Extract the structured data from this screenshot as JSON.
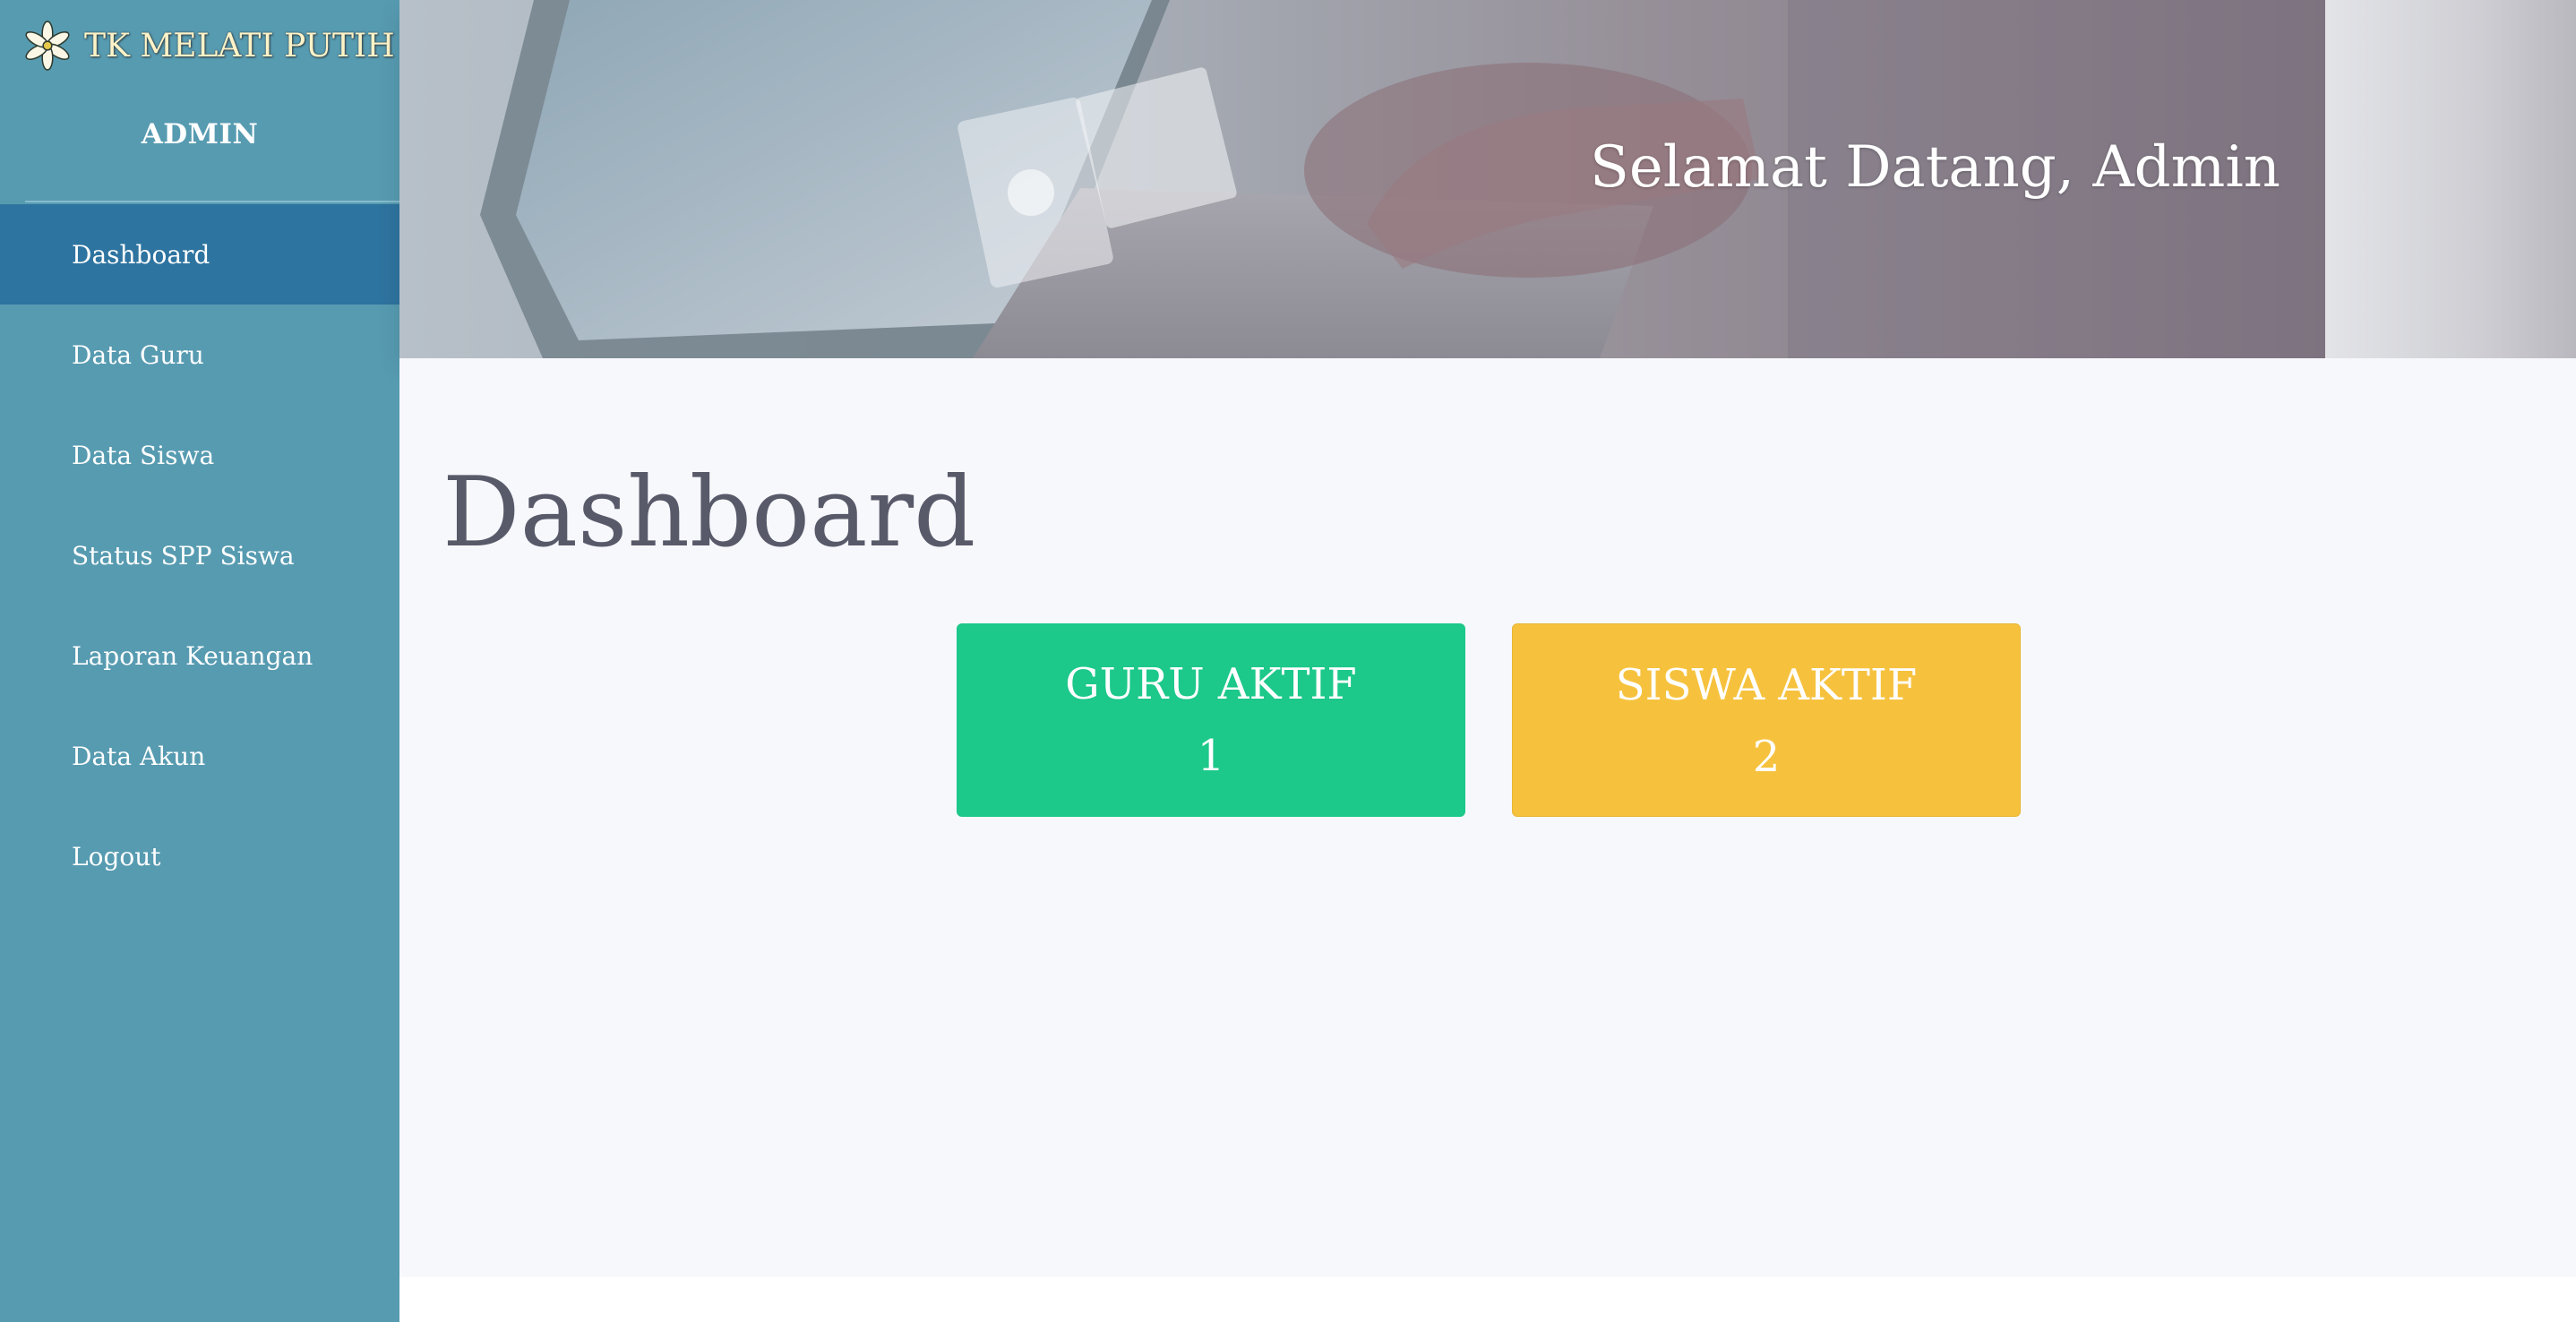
{
  "brand": {
    "name": "TK MELATI PUTIH",
    "logo_icon": "jasmine-flower-icon"
  },
  "sidebar": {
    "role_label": "ADMIN",
    "items": [
      {
        "label": "Dashboard",
        "active": true
      },
      {
        "label": "Data Guru"
      },
      {
        "label": "Data Siswa"
      },
      {
        "label": "Status SPP Siswa"
      },
      {
        "label": "Laporan Keuangan"
      },
      {
        "label": "Data Akun"
      },
      {
        "label": "Logout"
      }
    ]
  },
  "header": {
    "greeting": "Selamat Datang, Admin"
  },
  "main": {
    "title": "Dashboard",
    "cards": [
      {
        "label": "GURU AKTIF",
        "value": "1",
        "color": "#1cc88a"
      },
      {
        "label": "SISWA AKTIF",
        "value": "2",
        "color": "#f6c23e"
      }
    ]
  },
  "colors": {
    "sidebar_bg": "#579bb1",
    "sidebar_active": "#2e74a0",
    "main_bg": "#f7f8fc",
    "title_text": "#585a6a"
  }
}
